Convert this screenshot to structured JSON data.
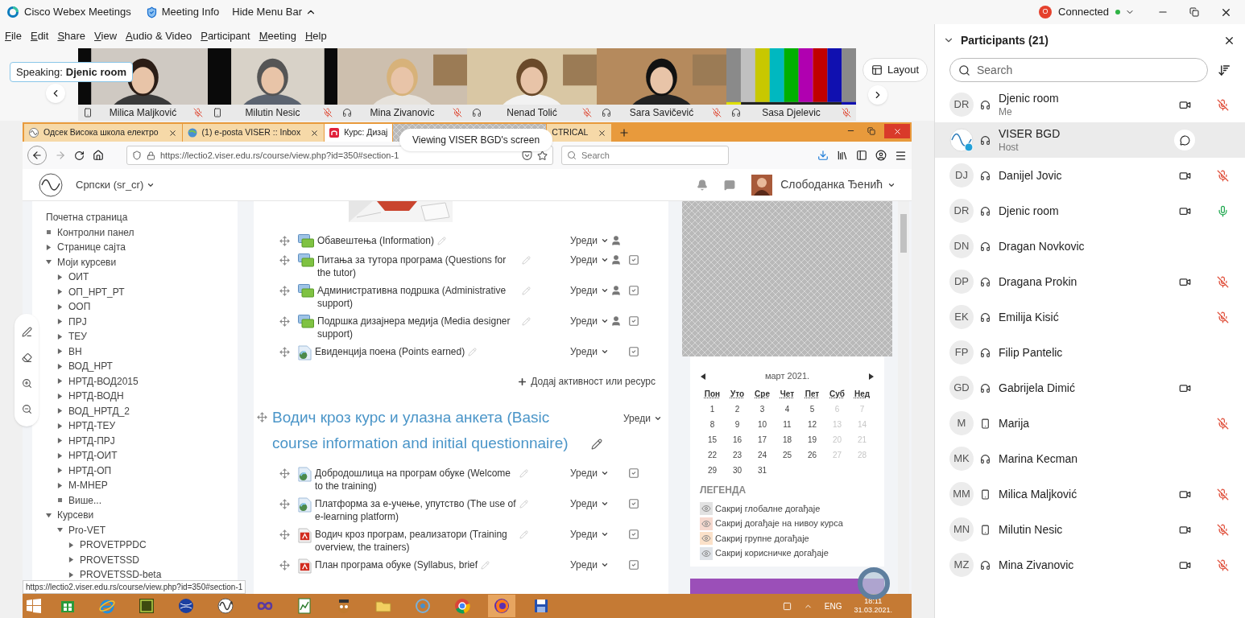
{
  "app": {
    "title": "Cisco Webex Meetings",
    "meeting_info": "Meeting Info",
    "hide_menu": "Hide Menu Bar",
    "account_initial": "O",
    "status": "Connected"
  },
  "menu": [
    "File",
    "Edit",
    "Share",
    "View",
    "Audio & Video",
    "Participant",
    "Meeting",
    "Help"
  ],
  "speaking": {
    "label": "Speaking:",
    "name": "Djenic room"
  },
  "videos": [
    {
      "name": "Milica Maljković",
      "phone": true,
      "muted": true,
      "kind": "person"
    },
    {
      "name": "Milutin Nesic",
      "phone": true,
      "muted": true,
      "kind": "person"
    },
    {
      "name": "Mina Zivanovic",
      "phone": false,
      "muted": true,
      "kind": "person"
    },
    {
      "name": "Nenad Tolić",
      "phone": false,
      "muted": true,
      "kind": "person"
    },
    {
      "name": "Sara Savičević",
      "phone": false,
      "muted": true,
      "kind": "person"
    },
    {
      "name": "Sasa Djelevic",
      "phone": false,
      "muted": true,
      "kind": "color_bars"
    }
  ],
  "layout_button": "Layout",
  "share_banner": "Viewing VISER BGD's screen",
  "browser": {
    "tabs": [
      {
        "title": "Одсек Висока школа електро",
        "selected": false,
        "close": true
      },
      {
        "title": "(1) e-posta VISER :: Inbox",
        "selected": false,
        "close": true
      },
      {
        "title": "Курс: Дизај",
        "selected": true,
        "close": false
      },
      {
        "title": "CTRICAL",
        "selected": false,
        "close": true
      }
    ],
    "url": "https://lectio2.viser.edu.rs/course/view.php?id=350#section-1",
    "search_placeholder": "Search"
  },
  "moodle": {
    "language": "Српски (sr_cr)",
    "user": "Слободанка Ђенић"
  },
  "nav_tree": [
    {
      "label": "Почетна страница",
      "kind": "plain"
    },
    {
      "label": "Контролни панел",
      "kind": "leaf"
    },
    {
      "label": "Странице сајта",
      "kind": "branch",
      "expanded": false
    },
    {
      "label": "Моји курсеви",
      "kind": "branch",
      "expanded": true,
      "children": [
        {
          "label": "ОИТ",
          "kind": "branch",
          "expanded": false
        },
        {
          "label": "ОП_НРТ_РТ",
          "kind": "branch",
          "expanded": false
        },
        {
          "label": "ООП",
          "kind": "branch",
          "expanded": false
        },
        {
          "label": "ПРЈ",
          "kind": "branch",
          "expanded": false
        },
        {
          "label": "ТЕУ",
          "kind": "branch",
          "expanded": false
        },
        {
          "label": "ВН",
          "kind": "branch",
          "expanded": false
        },
        {
          "label": "ВОД_НРТ",
          "kind": "branch",
          "expanded": false
        },
        {
          "label": "НРТД-ВОД2015",
          "kind": "branch",
          "expanded": false
        },
        {
          "label": "НРТД-ВОДН",
          "kind": "branch",
          "expanded": false
        },
        {
          "label": "ВОД_НРТД_2",
          "kind": "branch",
          "expanded": false
        },
        {
          "label": "НРТД-ТЕУ",
          "kind": "branch",
          "expanded": false
        },
        {
          "label": "НРТД-ПРЈ",
          "kind": "branch",
          "expanded": false
        },
        {
          "label": "НРТД-ОИТ",
          "kind": "branch",
          "expanded": false
        },
        {
          "label": "НРТД-ОП",
          "kind": "branch",
          "expanded": false
        },
        {
          "label": "М-МНЕР",
          "kind": "branch",
          "expanded": false
        },
        {
          "label": "Више...",
          "kind": "leaf"
        }
      ]
    },
    {
      "label": "Курсеви",
      "kind": "branch",
      "expanded": true,
      "children": [
        {
          "label": "Pro-VET",
          "kind": "branch",
          "expanded": true,
          "children": [
            {
              "label": "PROVETPPDC",
              "kind": "branch",
              "expanded": false
            },
            {
              "label": "PROVETSSD",
              "kind": "branch",
              "expanded": false
            },
            {
              "label": "PROVETSSD-beta",
              "kind": "branch",
              "expanded": false
            }
          ]
        }
      ]
    }
  ],
  "activities_top": [
    {
      "kind": "forum",
      "title": "Обавештења (Information)",
      "edit": "Уреди",
      "group_icon": true,
      "completion": false
    },
    {
      "kind": "forum",
      "title": "Питања за тутора програма (Questions for the tutor)",
      "edit": "Уреди",
      "group_icon": true,
      "completion": true
    },
    {
      "kind": "forum",
      "title": "Административна подршка (Administrative support)",
      "edit": "Уреди",
      "group_icon": true,
      "completion": true
    },
    {
      "kind": "forum",
      "title": "Подршка дизајнера медија (Media designer support)",
      "edit": "Уреди",
      "group_icon": true,
      "completion": true
    },
    {
      "kind": "page",
      "title": "Евиденција поена (Points earned)",
      "edit": "Уреди",
      "group_icon": false,
      "completion": true
    }
  ],
  "add_activity": "Додај активност или ресурс",
  "section": {
    "title": "Водич кроз курс и улазна анкета (Basic course information and initial questionnaire)",
    "edit": "Уреди"
  },
  "activities_section": [
    {
      "kind": "page",
      "title": "Добродошлица на програм обуке (Welcome to the training)",
      "edit": "Уреди",
      "group_icon": false,
      "completion": true
    },
    {
      "kind": "page",
      "title": "Платформа за е-учење, упутство (The use of e-learning platform)",
      "edit": "Уреди",
      "group_icon": false,
      "completion": true
    },
    {
      "kind": "pdf",
      "title": "Водич кроз програм, реализатори (Training overview, the trainers)",
      "edit": "Уреди",
      "group_icon": false,
      "completion": true
    },
    {
      "kind": "pdf",
      "title": "План програма обуке (Syllabus, brief",
      "edit": "Уреди",
      "group_icon": false,
      "completion": true
    }
  ],
  "calendar": {
    "month": "март 2021.",
    "weekdays": [
      "Пон",
      "Уто",
      "Сре",
      "Чет",
      "Пет",
      "Суб",
      "Нед"
    ],
    "weeks": [
      [
        "1",
        "2",
        "3",
        "4",
        "5",
        "6",
        "7"
      ],
      [
        "8",
        "9",
        "10",
        "11",
        "12",
        "13",
        "14"
      ],
      [
        "15",
        "16",
        "17",
        "18",
        "19",
        "20",
        "21"
      ],
      [
        "22",
        "23",
        "24",
        "25",
        "26",
        "27",
        "28"
      ],
      [
        "29",
        "30",
        "31"
      ]
    ]
  },
  "legend": {
    "title": "ЛЕГЕНДА",
    "items": [
      {
        "label": "Сакриј глобалне догађаје",
        "color": "#e2e2e2"
      },
      {
        "label": "Сакриј догађаје на нивоу курса",
        "color": "#f6d9cf"
      },
      {
        "label": "Сакриј групне догађаје",
        "color": "#fbe1c9"
      },
      {
        "label": "Сакриј корисничке догађаје",
        "color": "#dfe3e8"
      }
    ]
  },
  "status_url": "https://lectio2.viser.edu.rs/course/view.php?id=350#section-1",
  "taskbar": {
    "apps": [
      {
        "kind": "store",
        "selected": false
      },
      {
        "kind": "ie",
        "selected": false
      },
      {
        "kind": "dw",
        "selected": false
      },
      {
        "kind": "globe",
        "selected": false
      },
      {
        "kind": "wave",
        "selected": false
      },
      {
        "kind": "infinity",
        "selected": false
      },
      {
        "kind": "chart",
        "selected": false
      },
      {
        "kind": "owl",
        "selected": false
      },
      {
        "kind": "folder",
        "selected": false
      },
      {
        "kind": "ring",
        "selected": false
      },
      {
        "kind": "chrome",
        "selected": false
      },
      {
        "kind": "firefox",
        "selected": true
      },
      {
        "kind": "floppy",
        "selected": false
      }
    ],
    "language": "ENG",
    "time": "18:11",
    "date": "31.03.2021."
  },
  "participants": {
    "title": "Participants (21)",
    "search_placeholder": "Search",
    "rows": [
      {
        "kind": "initials",
        "initials": "DR",
        "name": "Djenic room",
        "role": "Me",
        "phone": false,
        "video": true,
        "muted": true,
        "mic_on": false,
        "selected": false
      },
      {
        "kind": "logo",
        "name": "VISER BGD",
        "role": "Host",
        "phone": false,
        "video": false,
        "muted": false,
        "mic_on": false,
        "selected": true
      },
      {
        "kind": "initials",
        "initials": "DJ",
        "name": "Danijel Jovic",
        "phone": false,
        "video": true,
        "muted": true,
        "mic_on": false,
        "selected": false
      },
      {
        "kind": "initials",
        "initials": "DR",
        "name": "Djenic room",
        "phone": false,
        "video": true,
        "muted": false,
        "mic_on": true,
        "selected": false
      },
      {
        "kind": "initials",
        "initials": "DN",
        "name": "Dragan Novkovic",
        "phone": false,
        "video": false,
        "muted": false,
        "mic_on": false,
        "selected": false
      },
      {
        "kind": "initials",
        "initials": "DP",
        "name": "Dragana Prokin",
        "phone": false,
        "video": true,
        "muted": true,
        "mic_on": false,
        "selected": false
      },
      {
        "kind": "initials",
        "initials": "EK",
        "name": "Emilija Kisić",
        "phone": false,
        "video": false,
        "muted": true,
        "mic_on": false,
        "selected": false
      },
      {
        "kind": "initials",
        "initials": "FP",
        "name": "Filip Pantelic",
        "phone": false,
        "video": false,
        "muted": false,
        "mic_on": false,
        "selected": false
      },
      {
        "kind": "initials",
        "initials": "GD",
        "name": "Gabrijela Dimić",
        "phone": false,
        "video": true,
        "muted": false,
        "mic_on": false,
        "selected": false
      },
      {
        "kind": "initials",
        "initials": "M",
        "name": "Marija",
        "phone": true,
        "video": false,
        "muted": true,
        "mic_on": false,
        "selected": false
      },
      {
        "kind": "initials",
        "initials": "MK",
        "name": "Marina Kecman",
        "phone": false,
        "video": false,
        "muted": false,
        "mic_on": false,
        "selected": false
      },
      {
        "kind": "initials",
        "initials": "MM",
        "name": "Milica Maljković",
        "phone": true,
        "video": true,
        "muted": true,
        "mic_on": false,
        "selected": false
      },
      {
        "kind": "initials",
        "initials": "MN",
        "name": "Milutin Nesic",
        "phone": true,
        "video": true,
        "muted": true,
        "mic_on": false,
        "selected": false
      },
      {
        "kind": "initials",
        "initials": "MZ",
        "name": "Mina Zivanovic",
        "phone": false,
        "video": true,
        "muted": true,
        "mic_on": false,
        "selected": false
      }
    ]
  }
}
